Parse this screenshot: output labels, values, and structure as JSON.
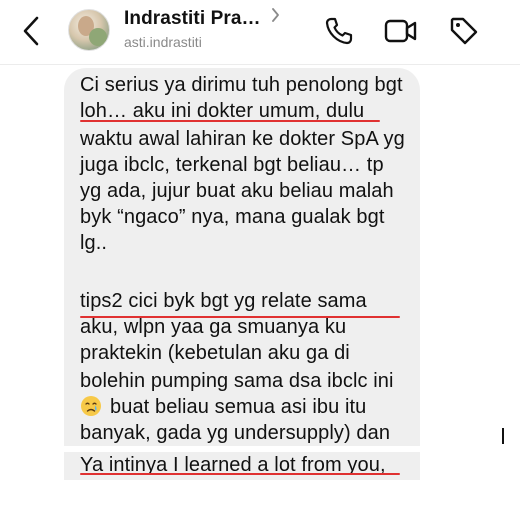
{
  "header": {
    "contact_name": "Indrastiti Pra…",
    "username": "asti.indrastiti",
    "icons": {
      "back": "chevron-left-icon",
      "name_chevron": "chevron-right-icon",
      "phone": "phone-icon",
      "video": "video-camera-icon",
      "tag": "tag-icon"
    }
  },
  "message": {
    "lines": [
      "Ci serius ya dirimu tuh penolong bgt",
      "loh… aku ini dokter umum, dulu",
      "waktu awal lahiran ke dokter SpA yg",
      "juga ibclc, terkenal bgt beliau… tp",
      "yg ada, jujur buat aku beliau malah",
      "byk “ngaco” nya, mana gualak bgt",
      "lg..",
      "",
      "tips2 cici byk bgt yg relate sama",
      "aku, wlpn yaa ga smuanya ku",
      "praktekin (kebetulan aku ga di",
      "bolehin pumping sama dsa ibclc ini",
      "buat beliau semua asi ibu itu",
      "banyak, gada yg undersupply) dan",
      "Ya intinya I learned a lot from you,"
    ],
    "emoji": "crying-face-emoji"
  },
  "colors": {
    "bubble_background": "#efefef",
    "underline": "#e03131",
    "secondary_text": "#8a8a8a"
  }
}
